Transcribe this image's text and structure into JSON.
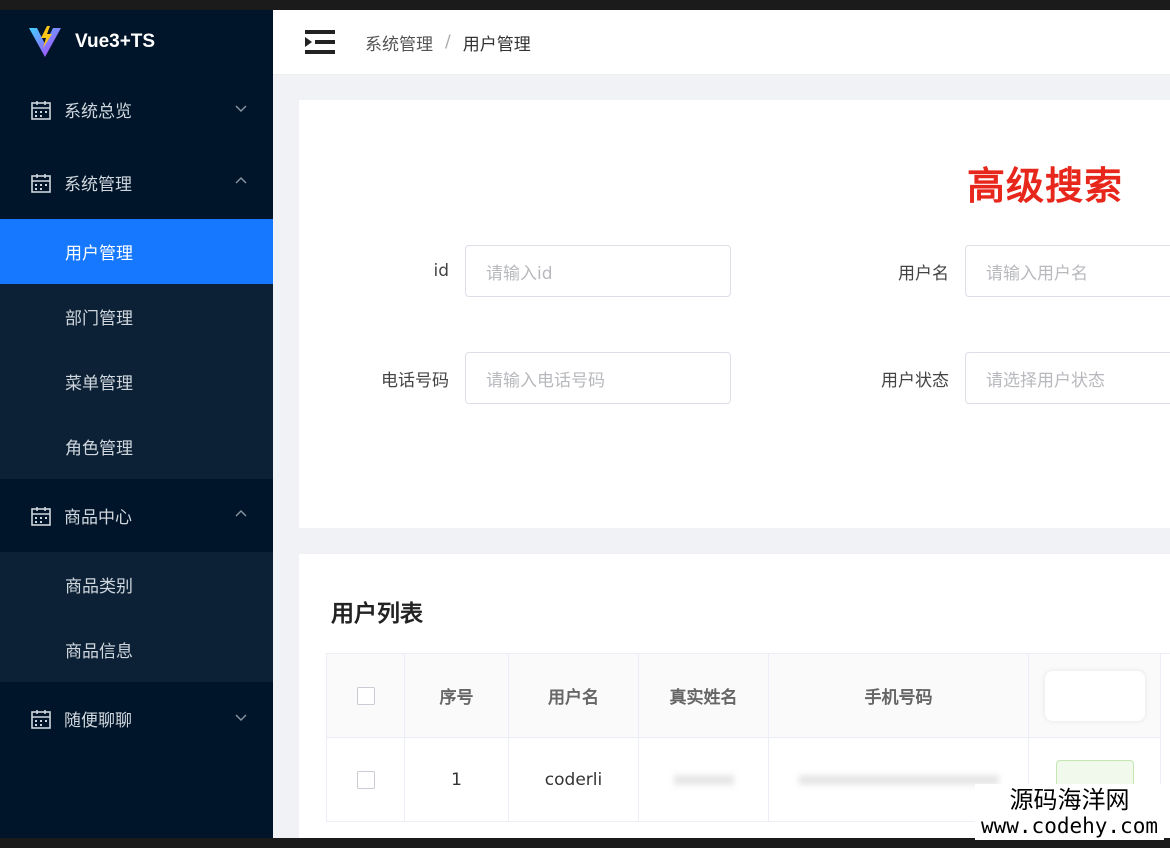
{
  "app": {
    "title": "Vue3+TS"
  },
  "sidebar": {
    "groups": [
      {
        "label": "系统总览",
        "expanded": false,
        "items": []
      },
      {
        "label": "系统管理",
        "expanded": true,
        "items": [
          {
            "label": "用户管理",
            "active": true
          },
          {
            "label": "部门管理",
            "active": false
          },
          {
            "label": "菜单管理",
            "active": false
          },
          {
            "label": "角色管理",
            "active": false
          }
        ]
      },
      {
        "label": "商品中心",
        "expanded": true,
        "items": [
          {
            "label": "商品类别",
            "active": false
          },
          {
            "label": "商品信息",
            "active": false
          }
        ]
      },
      {
        "label": "随便聊聊",
        "expanded": false,
        "items": []
      }
    ]
  },
  "header": {
    "breadcrumb": [
      "系统管理",
      "用户管理"
    ],
    "separator": "/"
  },
  "search": {
    "title": "高级搜索",
    "fields": {
      "id": {
        "label": "id",
        "placeholder": "请输入id"
      },
      "username": {
        "label": "用户名",
        "placeholder": "请输入用户名"
      },
      "phone": {
        "label": "电话号码",
        "placeholder": "请输入电话号码"
      },
      "status": {
        "label": "用户状态",
        "placeholder": "请选择用户状态"
      }
    }
  },
  "list": {
    "title": "用户列表",
    "columns": [
      "序号",
      "用户名",
      "真实姓名",
      "手机号码"
    ],
    "rows": [
      {
        "index": "1",
        "username": "coderli"
      }
    ]
  },
  "watermark": {
    "line1": "源码海洋网",
    "line2": "www.codehy.com"
  },
  "colors": {
    "sidebar_bg": "#001529",
    "active_bg": "#1677ff",
    "search_title": "#e8271c"
  }
}
